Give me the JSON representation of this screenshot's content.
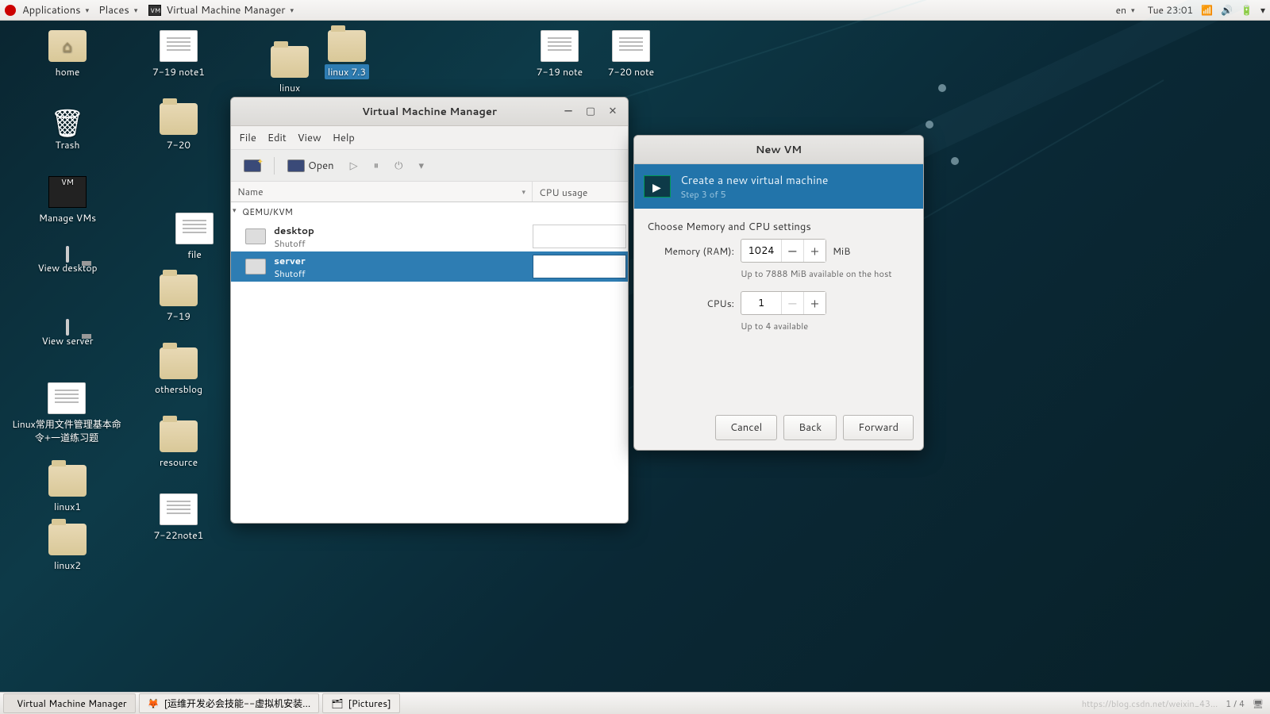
{
  "topbar": {
    "applications": "Applications",
    "places": "Places",
    "app_title": "Virtual Machine Manager",
    "lang": "en",
    "clock": "Tue 23:01"
  },
  "desktop_icons": {
    "home": "home",
    "note719_1": "7-19 note1",
    "linux": "linux",
    "linux73": "linux 7.3",
    "note719": "7-19 note",
    "note720": "7-20 note",
    "trash": "Trash",
    "f720": "7-20",
    "manage_vms": "Manage VMs",
    "file": "file",
    "view_desktop": "View desktop",
    "f719": "7-19",
    "view_server": "View server",
    "othersblog": "othersblog",
    "linux_doc": "Linux常用文件管理基本命令+一道练习题",
    "resource": "resource",
    "linux1": "linux1",
    "note722_1": "7-22note1",
    "linux2": "linux2"
  },
  "vmm": {
    "title": "Virtual Machine Manager",
    "menu": {
      "file": "File",
      "edit": "Edit",
      "view": "View",
      "help": "Help"
    },
    "toolbar": {
      "open": "Open"
    },
    "cols": {
      "name": "Name",
      "cpu": "CPU usage"
    },
    "group": "QEMU/KVM",
    "vms": [
      {
        "name": "desktop",
        "status": "Shutoff"
      },
      {
        "name": "server",
        "status": "Shutoff"
      }
    ]
  },
  "newvm": {
    "title": "New VM",
    "header_title": "Create a new virtual machine",
    "header_step": "Step 3 of 5",
    "section": "Choose Memory and CPU settings",
    "mem_label": "Memory (RAM):",
    "mem_value": "1024",
    "mem_unit": "MiB",
    "mem_hint": "Up to 7888 MiB available on the host",
    "cpu_label": "CPUs:",
    "cpu_value": "1",
    "cpu_hint": "Up to 4 available",
    "btn_cancel": "Cancel",
    "btn_back": "Back",
    "btn_forward": "Forward"
  },
  "panel": {
    "t1": "Virtual Machine Manager",
    "t2": "[运维开发必会技能--虚拟机安装...",
    "t3": "[Pictures]",
    "pager": "1 / 4",
    "watermark": "https://blog.csdn.net/weixin_43..."
  }
}
